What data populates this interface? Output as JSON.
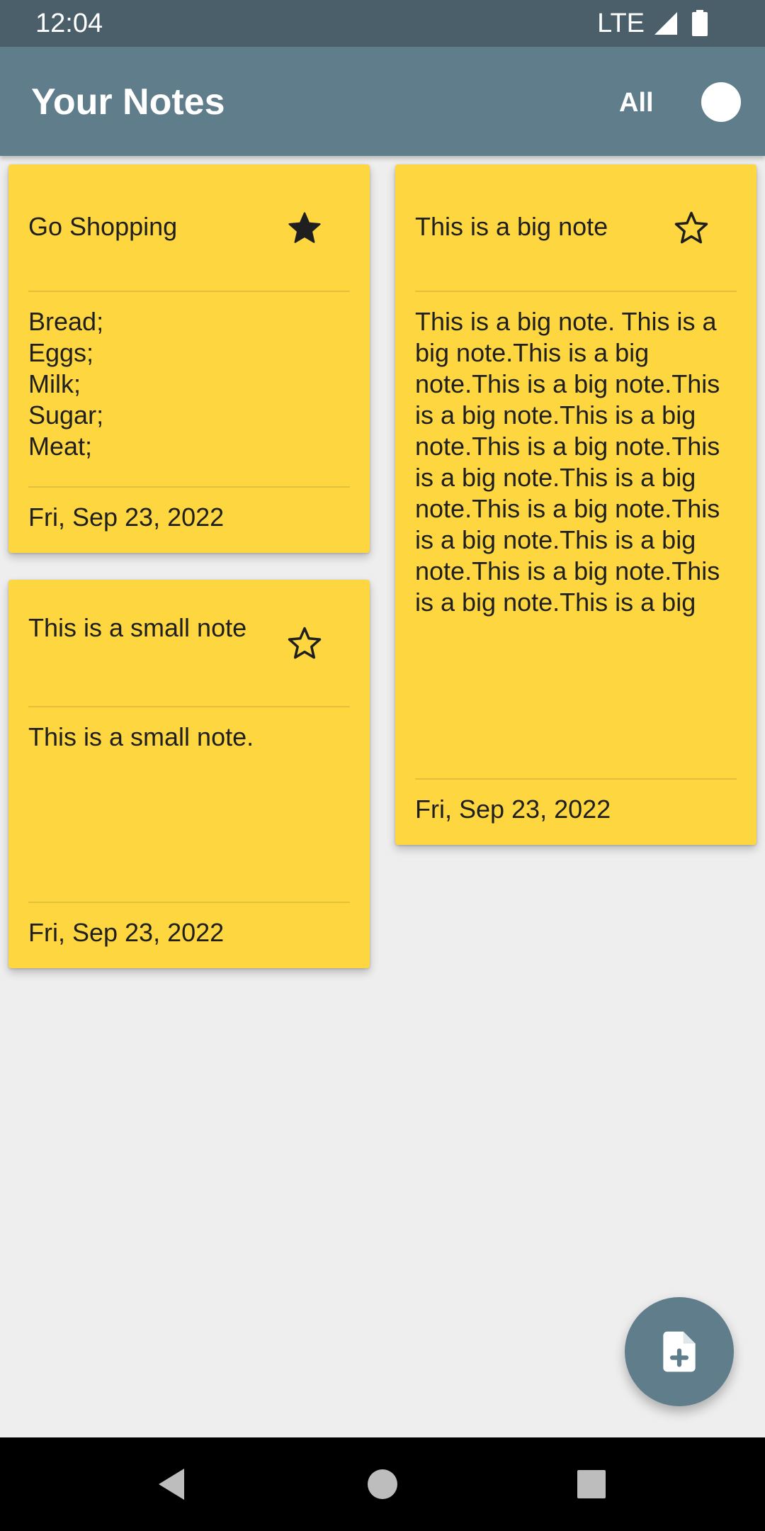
{
  "status_bar": {
    "time": "12:04",
    "network": "LTE",
    "icons": [
      "signal-icon",
      "battery-icon"
    ]
  },
  "app_bar": {
    "title": "Your Notes",
    "filter_label": "All",
    "filter_toggle_on": false,
    "color": "#607d8b"
  },
  "notes": [
    {
      "title": "Go Shopping",
      "starred": true,
      "body": "Bread;\nEggs;\nMilk;\nSugar;\nMeat;",
      "date": "Fri, Sep 23, 2022",
      "color": "#fdd640"
    },
    {
      "title": "This is a small note",
      "starred": false,
      "body": "This is a small note.",
      "date": "Fri, Sep 23, 2022",
      "color": "#fdd640"
    },
    {
      "title": "This is a big note",
      "starred": false,
      "body": "This is a big note. This is a big note.This is a big note.This is a big note.This is a big note.This is a big note.This is a big note.This is a big note.This is a big note.This is a big note.This is a big note.This is a big note.This is a big note.This is a big note.This is a big",
      "date": "Fri, Sep 23, 2022",
      "color": "#fdd640"
    }
  ],
  "fab": {
    "icon": "add-note-icon"
  },
  "nav_bar": {
    "icons": [
      "back-icon",
      "home-icon",
      "recents-icon"
    ]
  }
}
